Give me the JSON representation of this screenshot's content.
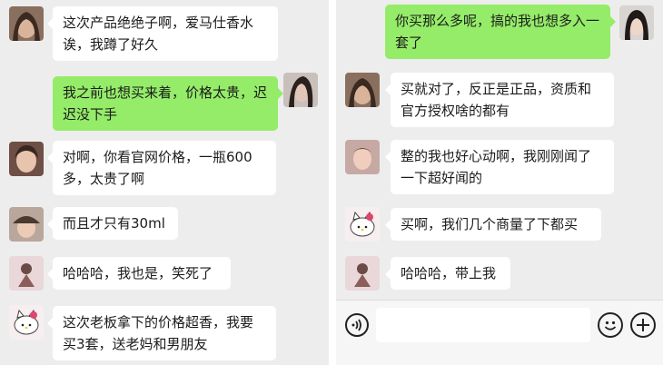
{
  "left_chat": {
    "messages": [
      {
        "side": "received",
        "avatar": "avatar-woman-long-hair",
        "text": "这次产品绝绝子啊，爱马仕香水诶，我蹲了好久"
      },
      {
        "side": "sent",
        "avatar": "avatar-woman-portrait",
        "text": "我之前也想买来着，价格太贵，迟迟没下手"
      },
      {
        "side": "received",
        "avatar": "avatar-woman-face",
        "text": "对啊，你看官网价格，一瓶600多，太贵了啊"
      },
      {
        "side": "received",
        "avatar": "avatar-girl-hat",
        "text": "而且才只有30ml"
      },
      {
        "side": "received",
        "avatar": "avatar-figure-pink",
        "text": "哈哈哈，我也是，笑死了"
      },
      {
        "side": "received",
        "avatar": "avatar-hello-kitty",
        "text": "这次老板拿下的价格超香，我要买3套，送老妈和男朋友"
      }
    ]
  },
  "right_chat": {
    "messages": [
      {
        "side": "sent",
        "avatar": "avatar-woman-dark-hair",
        "text": "你买那么多呢，搞的我也想多入一套了"
      },
      {
        "side": "received",
        "avatar": "avatar-woman-long-hair",
        "text": "买就对了，反正是正品，资质和官方授权啥的都有"
      },
      {
        "side": "received",
        "avatar": "avatar-child-pink",
        "text": "整的我也好心动啊，我刚刚闻了一下超好闻的"
      },
      {
        "side": "received",
        "avatar": "avatar-hello-kitty",
        "text": "买啊，我们几个商量了下都买"
      },
      {
        "side": "received",
        "avatar": "avatar-figure-pink",
        "text": "哈哈哈，带上我"
      }
    ]
  },
  "input_bar": {
    "voice_icon": "voice-icon",
    "emoji_icon": "emoji-icon",
    "plus_icon": "plus-icon",
    "text_value": ""
  },
  "colors": {
    "sent_bubble": "#95ec69",
    "received_bubble": "#ffffff",
    "chat_background": "#ededed"
  }
}
